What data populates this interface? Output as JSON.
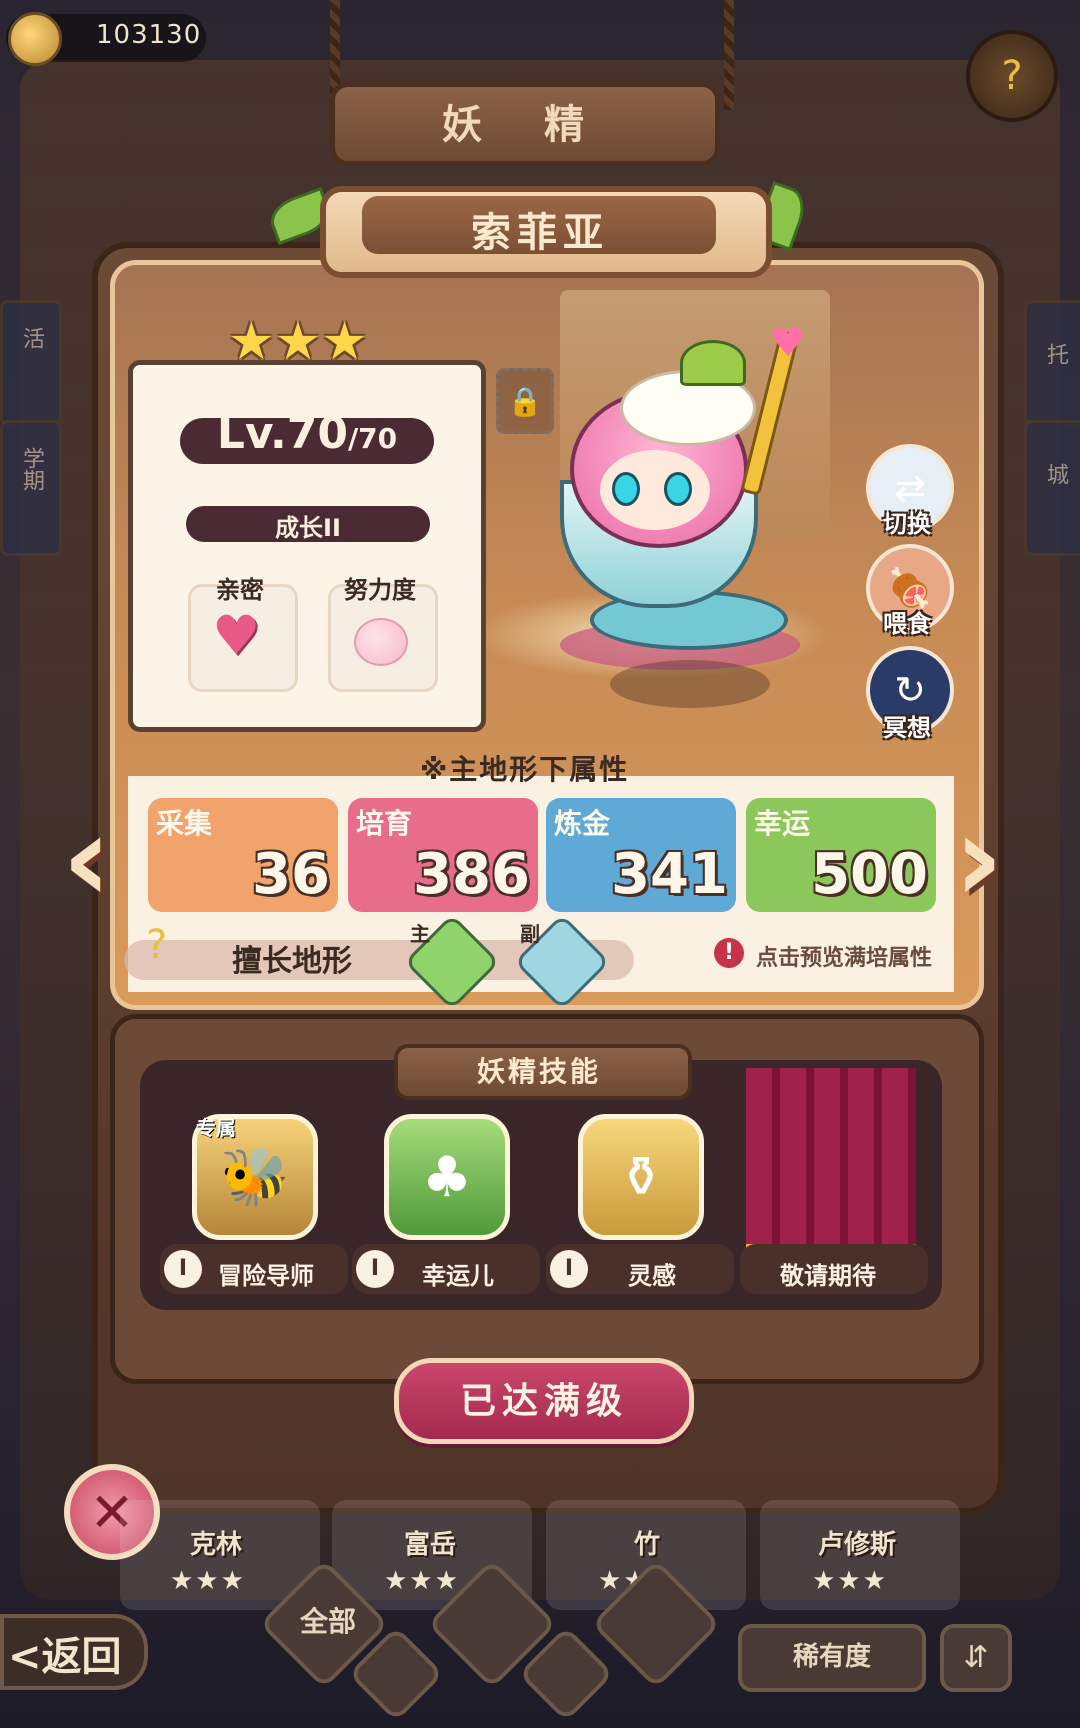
{
  "currency": {
    "amount": "103130",
    "icon": "coin-icon"
  },
  "header": {
    "title": "妖 精",
    "help_icon": "help-sprout-icon"
  },
  "fairy": {
    "name": "索菲亚",
    "stars": 3,
    "level": "Lv.70",
    "level_max": "/70",
    "growth": "成长II",
    "intimacy_label": "亲密",
    "effort_label": "努力度"
  },
  "actions": [
    {
      "label": "切换",
      "icon": "switch-icon"
    },
    {
      "label": "喂食",
      "icon": "feed-meat-icon"
    },
    {
      "label": "冥想",
      "icon": "meditate-icon"
    }
  ],
  "attributes": {
    "section_title": "※主地形下属性",
    "items": [
      {
        "name": "采集",
        "value": "36",
        "color": "#f0a36b"
      },
      {
        "name": "培育",
        "value": "386",
        "color": "#e86d8b"
      },
      {
        "name": "炼金",
        "value": "341",
        "color": "#5ea9d6"
      },
      {
        "name": "幸运",
        "value": "500",
        "color": "#8bc75a"
      }
    ],
    "terrain_label": "擅长地形",
    "terrain_main_tag": "主",
    "terrain_sub_tag": "副",
    "preview_text": "点击预览满培属性"
  },
  "skills": {
    "title": "妖精技能",
    "exclusive_tag": "专属",
    "items": [
      {
        "name": "冒险导师",
        "level": "I",
        "icon": "bee-icon"
      },
      {
        "name": "幸运儿",
        "level": "I",
        "icon": "clover-icon"
      },
      {
        "name": "灵感",
        "level": "I",
        "icon": "pot-icon"
      },
      {
        "name": "敬请期待",
        "level": "",
        "icon": "curtain-icon"
      }
    ]
  },
  "max_button": "已达满级",
  "fairy_list": [
    {
      "name": "克林"
    },
    {
      "name": "富岳"
    },
    {
      "name": "竹"
    },
    {
      "name": "卢修斯"
    }
  ],
  "bottom_bar": {
    "back": "<返回",
    "filter_all": "全部",
    "rarity": "稀有度"
  },
  "side_tabs": {
    "left": [
      "活",
      "学期"
    ],
    "right": [
      "托",
      "城"
    ]
  }
}
